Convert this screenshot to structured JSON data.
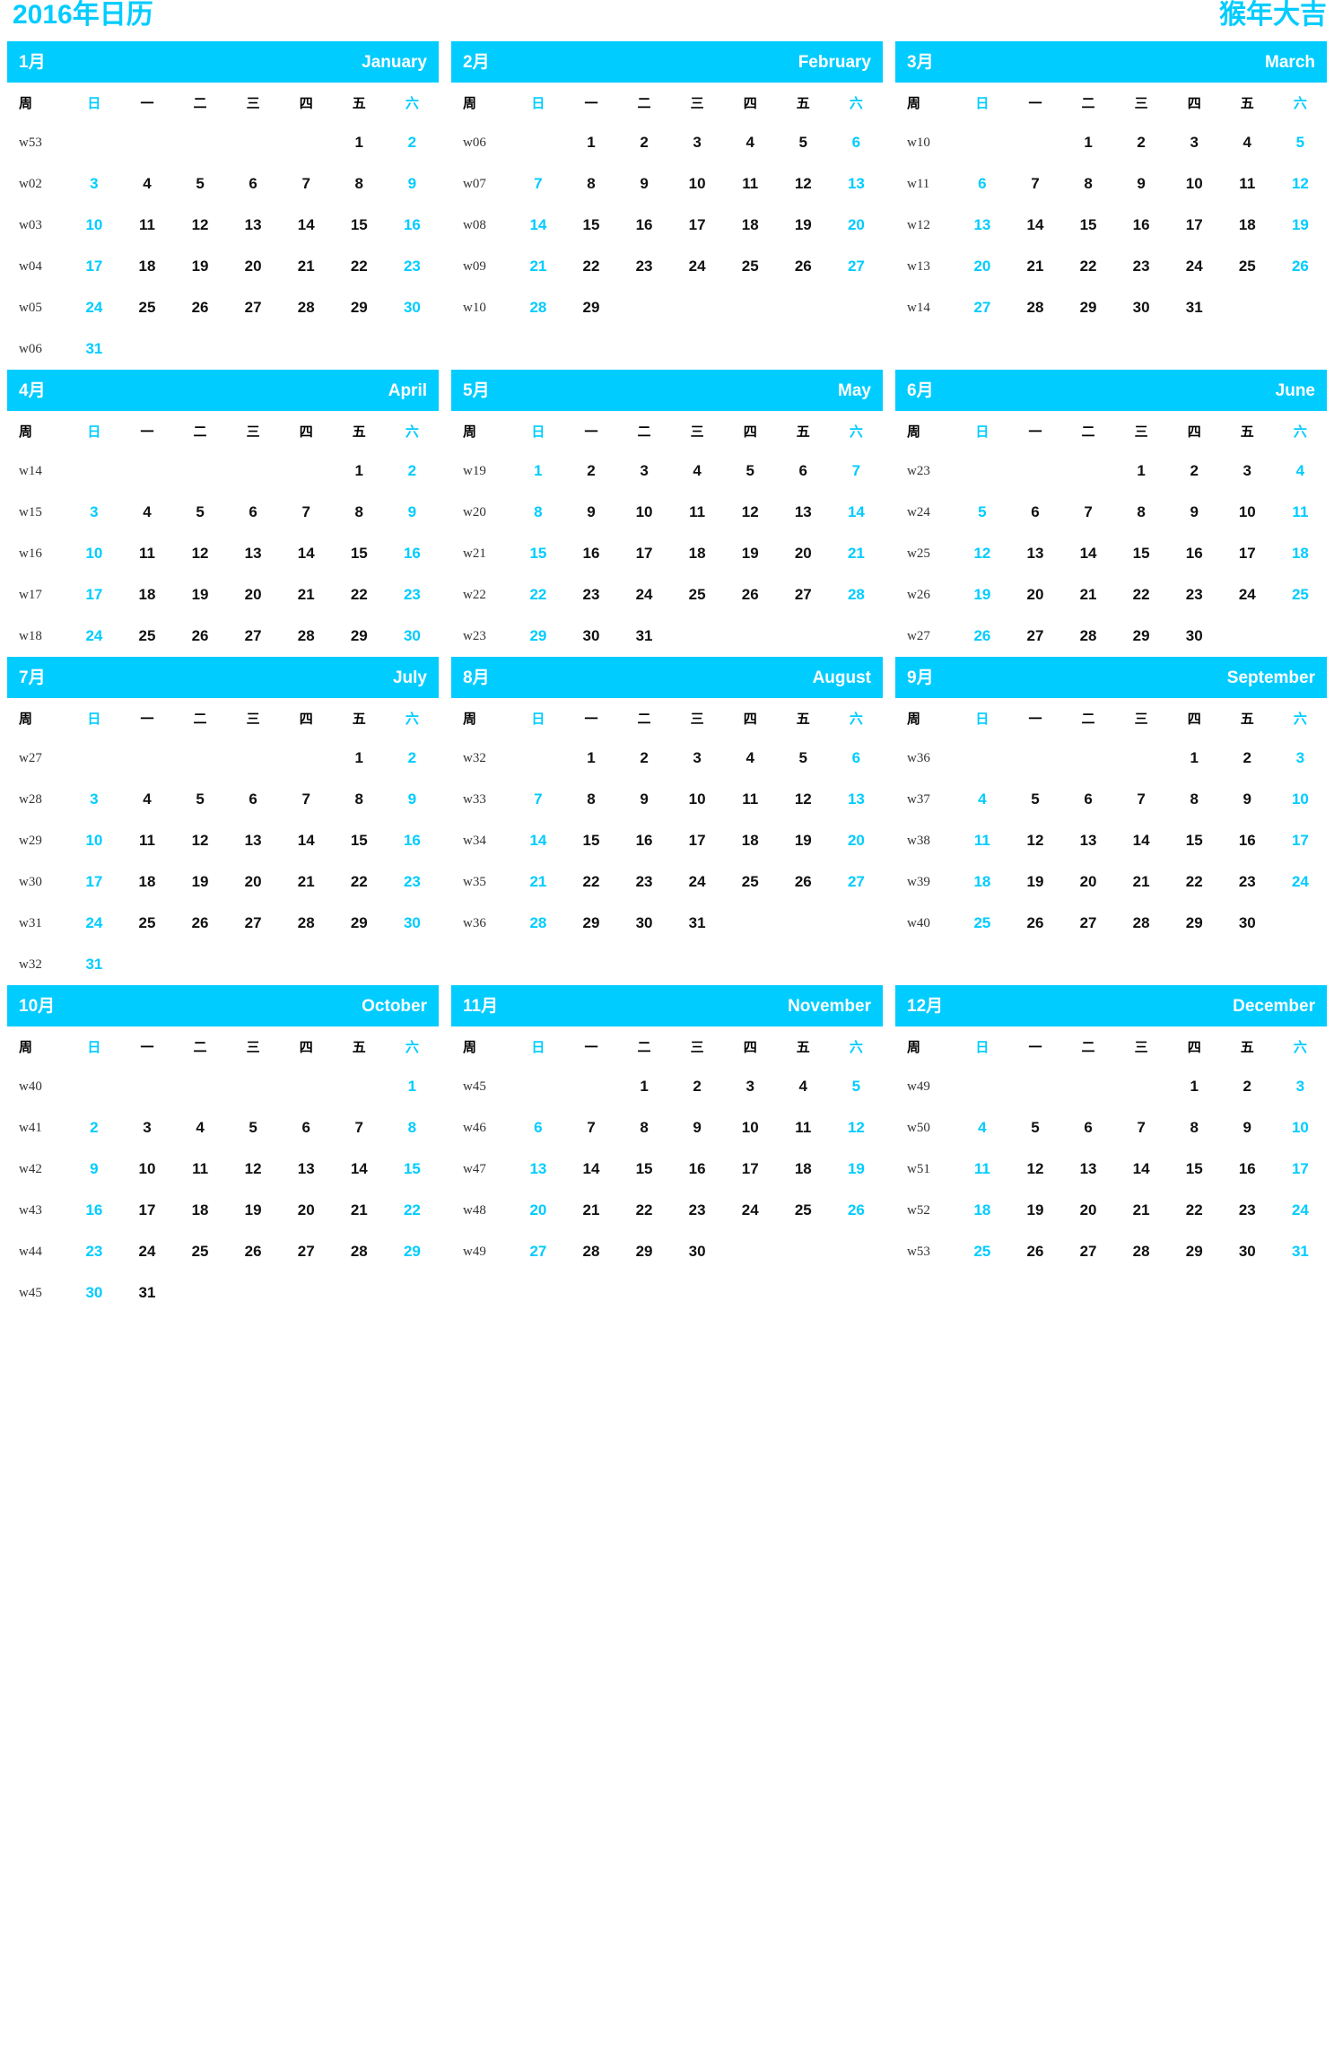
{
  "header": {
    "title_left": "2016年日历",
    "title_right": "猴年大吉"
  },
  "theme": {
    "accent": "#00ccff",
    "weekday_text": "#000000",
    "date_text": "#111111",
    "week_number_text": "#333333",
    "header_text": "#ffffff",
    "background": "#ffffff"
  },
  "weekday_headers": {
    "week_label": "周",
    "days": [
      "日",
      "一",
      "二",
      "三",
      "四",
      "五",
      "六"
    ]
  },
  "months": [
    {
      "cn": "1月",
      "en": "January",
      "weeks": [
        {
          "wk": "w53",
          "days": [
            "",
            "",
            "",
            "",
            "",
            "1",
            "2"
          ]
        },
        {
          "wk": "w02",
          "days": [
            "3",
            "4",
            "5",
            "6",
            "7",
            "8",
            "9"
          ]
        },
        {
          "wk": "w03",
          "days": [
            "10",
            "11",
            "12",
            "13",
            "14",
            "15",
            "16"
          ]
        },
        {
          "wk": "w04",
          "days": [
            "17",
            "18",
            "19",
            "20",
            "21",
            "22",
            "23"
          ]
        },
        {
          "wk": "w05",
          "days": [
            "24",
            "25",
            "26",
            "27",
            "28",
            "29",
            "30"
          ]
        },
        {
          "wk": "w06",
          "days": [
            "31",
            "",
            "",
            "",
            "",
            "",
            ""
          ]
        }
      ]
    },
    {
      "cn": "2月",
      "en": "February",
      "weeks": [
        {
          "wk": "w06",
          "days": [
            "",
            "1",
            "2",
            "3",
            "4",
            "5",
            "6"
          ]
        },
        {
          "wk": "w07",
          "days": [
            "7",
            "8",
            "9",
            "10",
            "11",
            "12",
            "13"
          ]
        },
        {
          "wk": "w08",
          "days": [
            "14",
            "15",
            "16",
            "17",
            "18",
            "19",
            "20"
          ]
        },
        {
          "wk": "w09",
          "days": [
            "21",
            "22",
            "23",
            "24",
            "25",
            "26",
            "27"
          ]
        },
        {
          "wk": "w10",
          "days": [
            "28",
            "29",
            "",
            "",
            "",
            "",
            ""
          ]
        },
        {
          "wk": "",
          "days": [
            "",
            "",
            "",
            "",
            "",
            "",
            ""
          ]
        }
      ]
    },
    {
      "cn": "3月",
      "en": "March",
      "weeks": [
        {
          "wk": "w10",
          "days": [
            "",
            "",
            "1",
            "2",
            "3",
            "4",
            "5"
          ]
        },
        {
          "wk": "w11",
          "days": [
            "6",
            "7",
            "8",
            "9",
            "10",
            "11",
            "12"
          ]
        },
        {
          "wk": "w12",
          "days": [
            "13",
            "14",
            "15",
            "16",
            "17",
            "18",
            "19"
          ]
        },
        {
          "wk": "w13",
          "days": [
            "20",
            "21",
            "22",
            "23",
            "24",
            "25",
            "26"
          ]
        },
        {
          "wk": "w14",
          "days": [
            "27",
            "28",
            "29",
            "30",
            "31",
            "",
            ""
          ]
        },
        {
          "wk": "",
          "days": [
            "",
            "",
            "",
            "",
            "",
            "",
            ""
          ]
        }
      ]
    },
    {
      "cn": "4月",
      "en": "April",
      "weeks": [
        {
          "wk": "w14",
          "days": [
            "",
            "",
            "",
            "",
            "",
            "1",
            "2"
          ]
        },
        {
          "wk": "w15",
          "days": [
            "3",
            "4",
            "5",
            "6",
            "7",
            "8",
            "9"
          ]
        },
        {
          "wk": "w16",
          "days": [
            "10",
            "11",
            "12",
            "13",
            "14",
            "15",
            "16"
          ]
        },
        {
          "wk": "w17",
          "days": [
            "17",
            "18",
            "19",
            "20",
            "21",
            "22",
            "23"
          ]
        },
        {
          "wk": "w18",
          "days": [
            "24",
            "25",
            "26",
            "27",
            "28",
            "29",
            "30"
          ]
        }
      ]
    },
    {
      "cn": "5月",
      "en": "May",
      "weeks": [
        {
          "wk": "w19",
          "days": [
            "1",
            "2",
            "3",
            "4",
            "5",
            "6",
            "7"
          ]
        },
        {
          "wk": "w20",
          "days": [
            "8",
            "9",
            "10",
            "11",
            "12",
            "13",
            "14"
          ]
        },
        {
          "wk": "w21",
          "days": [
            "15",
            "16",
            "17",
            "18",
            "19",
            "20",
            "21"
          ]
        },
        {
          "wk": "w22",
          "days": [
            "22",
            "23",
            "24",
            "25",
            "26",
            "27",
            "28"
          ]
        },
        {
          "wk": "w23",
          "days": [
            "29",
            "30",
            "31",
            "",
            "",
            "",
            ""
          ]
        }
      ]
    },
    {
      "cn": "6月",
      "en": "June",
      "weeks": [
        {
          "wk": "w23",
          "days": [
            "",
            "",
            "",
            "1",
            "2",
            "3",
            "4"
          ]
        },
        {
          "wk": "w24",
          "days": [
            "5",
            "6",
            "7",
            "8",
            "9",
            "10",
            "11"
          ]
        },
        {
          "wk": "w25",
          "days": [
            "12",
            "13",
            "14",
            "15",
            "16",
            "17",
            "18"
          ]
        },
        {
          "wk": "w26",
          "days": [
            "19",
            "20",
            "21",
            "22",
            "23",
            "24",
            "25"
          ]
        },
        {
          "wk": "w27",
          "days": [
            "26",
            "27",
            "28",
            "29",
            "30",
            "",
            ""
          ]
        }
      ]
    },
    {
      "cn": "7月",
      "en": "July",
      "weeks": [
        {
          "wk": "w27",
          "days": [
            "",
            "",
            "",
            "",
            "",
            "1",
            "2"
          ]
        },
        {
          "wk": "w28",
          "days": [
            "3",
            "4",
            "5",
            "6",
            "7",
            "8",
            "9"
          ]
        },
        {
          "wk": "w29",
          "days": [
            "10",
            "11",
            "12",
            "13",
            "14",
            "15",
            "16"
          ]
        },
        {
          "wk": "w30",
          "days": [
            "17",
            "18",
            "19",
            "20",
            "21",
            "22",
            "23"
          ]
        },
        {
          "wk": "w31",
          "days": [
            "24",
            "25",
            "26",
            "27",
            "28",
            "29",
            "30"
          ]
        },
        {
          "wk": "w32",
          "days": [
            "31",
            "",
            "",
            "",
            "",
            "",
            ""
          ]
        }
      ]
    },
    {
      "cn": "8月",
      "en": "August",
      "weeks": [
        {
          "wk": "w32",
          "days": [
            "",
            "1",
            "2",
            "3",
            "4",
            "5",
            "6"
          ]
        },
        {
          "wk": "w33",
          "days": [
            "7",
            "8",
            "9",
            "10",
            "11",
            "12",
            "13"
          ]
        },
        {
          "wk": "w34",
          "days": [
            "14",
            "15",
            "16",
            "17",
            "18",
            "19",
            "20"
          ]
        },
        {
          "wk": "w35",
          "days": [
            "21",
            "22",
            "23",
            "24",
            "25",
            "26",
            "27"
          ]
        },
        {
          "wk": "w36",
          "days": [
            "28",
            "29",
            "30",
            "31",
            "",
            "",
            ""
          ]
        },
        {
          "wk": "",
          "days": [
            "",
            "",
            "",
            "",
            "",
            "",
            ""
          ]
        }
      ]
    },
    {
      "cn": "9月",
      "en": "September",
      "weeks": [
        {
          "wk": "w36",
          "days": [
            "",
            "",
            "",
            "",
            "1",
            "2",
            "3"
          ]
        },
        {
          "wk": "w37",
          "days": [
            "4",
            "5",
            "6",
            "7",
            "8",
            "9",
            "10"
          ]
        },
        {
          "wk": "w38",
          "days": [
            "11",
            "12",
            "13",
            "14",
            "15",
            "16",
            "17"
          ]
        },
        {
          "wk": "w39",
          "days": [
            "18",
            "19",
            "20",
            "21",
            "22",
            "23",
            "24"
          ]
        },
        {
          "wk": "w40",
          "days": [
            "25",
            "26",
            "27",
            "28",
            "29",
            "30",
            ""
          ]
        },
        {
          "wk": "",
          "days": [
            "",
            "",
            "",
            "",
            "",
            "",
            ""
          ]
        }
      ]
    },
    {
      "cn": "10月",
      "en": "October",
      "weeks": [
        {
          "wk": "w40",
          "days": [
            "",
            "",
            "",
            "",
            "",
            "",
            "1"
          ]
        },
        {
          "wk": "w41",
          "days": [
            "2",
            "3",
            "4",
            "5",
            "6",
            "7",
            "8"
          ]
        },
        {
          "wk": "w42",
          "days": [
            "9",
            "10",
            "11",
            "12",
            "13",
            "14",
            "15"
          ]
        },
        {
          "wk": "w43",
          "days": [
            "16",
            "17",
            "18",
            "19",
            "20",
            "21",
            "22"
          ]
        },
        {
          "wk": "w44",
          "days": [
            "23",
            "24",
            "25",
            "26",
            "27",
            "28",
            "29"
          ]
        },
        {
          "wk": "w45",
          "days": [
            "30",
            "31",
            "",
            "",
            "",
            "",
            ""
          ]
        }
      ]
    },
    {
      "cn": "11月",
      "en": "November",
      "weeks": [
        {
          "wk": "w45",
          "days": [
            "",
            "",
            "1",
            "2",
            "3",
            "4",
            "5"
          ]
        },
        {
          "wk": "w46",
          "days": [
            "6",
            "7",
            "8",
            "9",
            "10",
            "11",
            "12"
          ]
        },
        {
          "wk": "w47",
          "days": [
            "13",
            "14",
            "15",
            "16",
            "17",
            "18",
            "19"
          ]
        },
        {
          "wk": "w48",
          "days": [
            "20",
            "21",
            "22",
            "23",
            "24",
            "25",
            "26"
          ]
        },
        {
          "wk": "w49",
          "days": [
            "27",
            "28",
            "29",
            "30",
            "",
            "",
            ""
          ]
        },
        {
          "wk": "",
          "days": [
            "",
            "",
            "",
            "",
            "",
            "",
            ""
          ]
        }
      ]
    },
    {
      "cn": "12月",
      "en": "December",
      "weeks": [
        {
          "wk": "w49",
          "days": [
            "",
            "",
            "",
            "",
            "1",
            "2",
            "3"
          ]
        },
        {
          "wk": "w50",
          "days": [
            "4",
            "5",
            "6",
            "7",
            "8",
            "9",
            "10"
          ]
        },
        {
          "wk": "w51",
          "days": [
            "11",
            "12",
            "13",
            "14",
            "15",
            "16",
            "17"
          ]
        },
        {
          "wk": "w52",
          "days": [
            "18",
            "19",
            "20",
            "21",
            "22",
            "23",
            "24"
          ]
        },
        {
          "wk": "w53",
          "days": [
            "25",
            "26",
            "27",
            "28",
            "29",
            "30",
            "31"
          ]
        },
        {
          "wk": "",
          "days": [
            "",
            "",
            "",
            "",
            "",
            "",
            ""
          ]
        }
      ]
    }
  ]
}
